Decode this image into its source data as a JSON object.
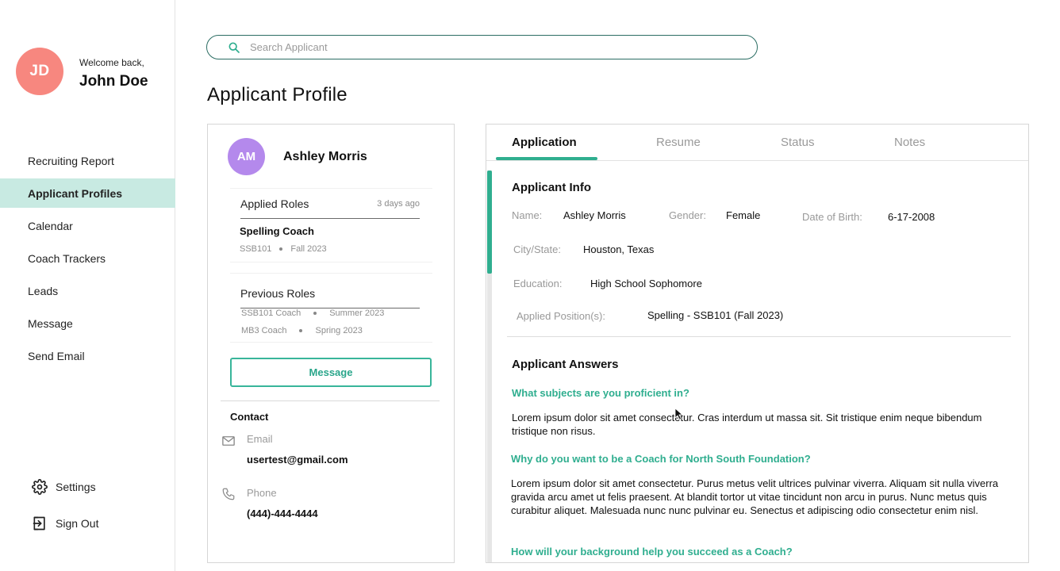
{
  "user": {
    "initials": "JD",
    "welcome": "Welcome back,",
    "name": "John Doe",
    "avatar_color": "#f7877f"
  },
  "nav": {
    "items": [
      {
        "label": "Recruiting Report"
      },
      {
        "label": "Applicant Profiles"
      },
      {
        "label": "Calendar"
      },
      {
        "label": "Coach Trackers"
      },
      {
        "label": "Leads"
      },
      {
        "label": "Message"
      },
      {
        "label": "Send Email"
      }
    ],
    "active_index": 1,
    "active_color": "#c8eae2"
  },
  "bottom_nav": {
    "settings": "Settings",
    "sign_out": "Sign Out"
  },
  "search": {
    "placeholder": "Search Applicant",
    "value": ""
  },
  "page_title": "Applicant Profile",
  "profile": {
    "initials": "AM",
    "avatar_color": "#b489ec",
    "name": "Ashley Morris",
    "applied_roles": {
      "title": "Applied Roles",
      "date": "3 days ago",
      "role": "Spelling Coach",
      "code": "SSB101",
      "term": "Fall 2023"
    },
    "previous_roles": {
      "title": "Previous Roles",
      "items": [
        {
          "role": "SSB101 Coach",
          "term": "Summer 2023"
        },
        {
          "role": "MB3 Coach",
          "term": "Spring 2023"
        }
      ]
    },
    "message_button": "Message",
    "contact": {
      "title": "Contact",
      "email_label": "Email",
      "email": "usertest@gmail.com",
      "phone_label": "Phone",
      "phone": "(444)-444-4444"
    }
  },
  "tabs": [
    {
      "label": "Application",
      "active": true
    },
    {
      "label": "Resume",
      "active": false
    },
    {
      "label": "Status",
      "active": false
    },
    {
      "label": "Notes",
      "active": false
    }
  ],
  "applicant_info": {
    "title": "Applicant Info",
    "name_label": "Name:",
    "name": "Ashley Morris",
    "gender_label": "Gender:",
    "gender": "Female",
    "dob_label": "Date of Birth:",
    "dob": "6-17-2008",
    "city_label": "City/State:",
    "city": "Houston, Texas",
    "education_label": "Education:",
    "education": "High School Sophomore",
    "position_label": "Applied Position(s):",
    "position": "Spelling - SSB101 (Fall 2023)"
  },
  "answers": {
    "title": "Applicant Answers",
    "items": [
      {
        "question": "What subjects are you proficient in?",
        "answer": "Lorem ipsum dolor sit amet consectetur. Cras interdum ut massa sit. Sit tristique enim neque bibendum tristique non risus."
      },
      {
        "question": "Why do you want to be a Coach for North South Foundation?",
        "answer": "Lorem ipsum dolor sit amet consectetur. Purus metus velit ultrices pulvinar viverra. Aliquam sit nulla viverra gravida arcu amet ut felis praesent. At blandit tortor ut vitae tincidunt non arcu in purus. Nunc metus quis curabitur aliquet. Malesuada nunc nunc pulvinar eu. Senectus et adipiscing odio consectetur enim nisl."
      },
      {
        "question": "How will your background help you succeed as a Coach?",
        "answer": ""
      }
    ]
  },
  "accent_color": "#2fae8f"
}
